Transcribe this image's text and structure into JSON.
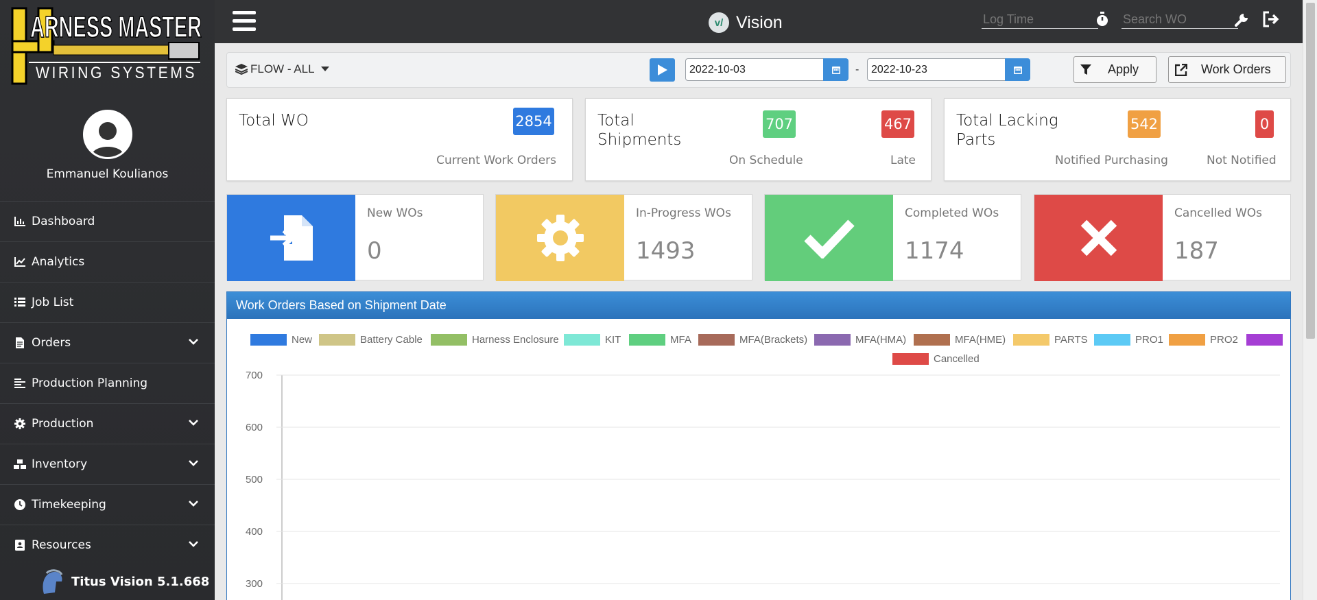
{
  "app": {
    "title": "Vision",
    "logo_text_top": "HARNESS MASTER",
    "logo_text_bottom": "WIRING SYSTEMS",
    "version": "Titus Vision 5.1.668"
  },
  "user": {
    "name": "Emmanuel Koulianos"
  },
  "topbar": {
    "log_time_placeholder": "Log Time",
    "search_placeholder": "Search WO"
  },
  "sidebar": {
    "items": [
      {
        "label": "Dashboard",
        "icon": "chart-bar-icon",
        "has_children": false
      },
      {
        "label": "Analytics",
        "icon": "chart-line-icon",
        "has_children": false
      },
      {
        "label": "Job List",
        "icon": "list-icon",
        "has_children": false
      },
      {
        "label": "Orders",
        "icon": "file-icon",
        "has_children": true
      },
      {
        "label": "Production Planning",
        "icon": "align-left-icon",
        "has_children": false
      },
      {
        "label": "Production",
        "icon": "cog-icon",
        "has_children": true
      },
      {
        "label": "Inventory",
        "icon": "boxes-icon",
        "has_children": true
      },
      {
        "label": "Timekeeping",
        "icon": "clock-icon",
        "has_children": true
      },
      {
        "label": "Resources",
        "icon": "address-book-icon",
        "has_children": true
      }
    ]
  },
  "filters": {
    "flow_label": "FLOW - ALL",
    "start_date": "2022-10-03",
    "end_date": "2022-10-23",
    "separator": "-",
    "apply_label": "Apply",
    "work_orders_label": "Work Orders"
  },
  "summary": {
    "total_wo": {
      "title": "Total WO",
      "value": "2854",
      "sub": "Current Work Orders"
    },
    "total_shipments": {
      "title_line1": "Total",
      "title_line2": "Shipments",
      "on_schedule": "707",
      "on_schedule_label": "On Schedule",
      "late": "467",
      "late_label": "Late"
    },
    "lacking_parts": {
      "title_line1": "Total Lacking",
      "title_line2": "Parts",
      "notified": "542",
      "notified_label": "Notified Purchasing",
      "not_notified": "0",
      "not_notified_label": "Not Notified"
    }
  },
  "tiles": [
    {
      "label": "New WOs",
      "value": "0",
      "color": "#2f7adf",
      "icon": "file-import-icon"
    },
    {
      "label": "In-Progress WOs",
      "value": "1493",
      "color": "#f2c962",
      "icon": "cog-icon"
    },
    {
      "label": "Completed WOs",
      "value": "1174",
      "color": "#63cd7b",
      "icon": "check-icon"
    },
    {
      "label": "Cancelled WOs",
      "value": "187",
      "color": "#de4a47",
      "icon": "times-icon"
    }
  ],
  "colors": {
    "new": "#2f7adf",
    "battery_cable": "#cfc587",
    "harness_enclosure": "#93bf65",
    "kit": "#7ee8d6",
    "mfa": "#5fcf80",
    "mfa_brackets": "#a76a5a",
    "mfa_hma": "#8b69b0",
    "mfa_hme": "#b0704f",
    "parts": "#f4c96a",
    "pro1": "#5ccaf5",
    "pro2": "#f0a043",
    "purple": "#a53ed4",
    "cancelled": "#de4a47"
  },
  "chart_panel": {
    "title": "Work Orders Based on Shipment Date"
  },
  "chart_data": {
    "type": "bar",
    "title": "",
    "series": [
      {
        "name": "New",
        "color": "#2f7adf"
      },
      {
        "name": "Battery Cable",
        "color": "#cfc587"
      },
      {
        "name": "Harness Enclosure",
        "color": "#93bf65"
      },
      {
        "name": "KIT",
        "color": "#7ee8d6"
      },
      {
        "name": "MFA",
        "color": "#5fcf80"
      },
      {
        "name": "MFA(Brackets)",
        "color": "#a76a5a"
      },
      {
        "name": "MFA(HMA)",
        "color": "#8b69b0"
      },
      {
        "name": "MFA(HME)",
        "color": "#b0704f"
      },
      {
        "name": "PARTS",
        "color": "#f4c96a"
      },
      {
        "name": "PRO1",
        "color": "#5ccaf5"
      },
      {
        "name": "PRO2",
        "color": "#f0a043"
      },
      {
        "name": "",
        "color": "#a53ed4"
      },
      {
        "name": "Cancelled",
        "color": "#de4a47"
      }
    ],
    "y_ticks": [
      700,
      600,
      500,
      400,
      300
    ],
    "ylim": [
      300,
      700
    ],
    "grid": true,
    "legend_position": "top"
  }
}
